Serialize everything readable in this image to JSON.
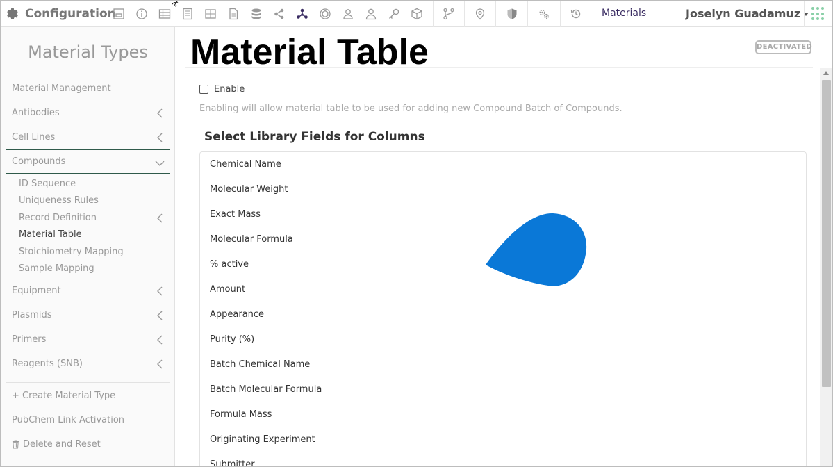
{
  "app": {
    "title": "Configuration"
  },
  "header": {
    "nav_link": "Materials",
    "user_name": "Joselyn Guadamuz",
    "icons": [
      "form-icon",
      "info-icon",
      "table-icon",
      "notebook-icon",
      "grid-icon",
      "document-icon",
      "database-icon",
      "share-icon",
      "molecule-icon",
      "hexagon-icon",
      "user-group-icon",
      "user-icon",
      "key-icon",
      "cube-icon",
      "branch-icon",
      "location-pin-icon",
      "shield-icon",
      "settings-gears-icon",
      "history-icon",
      "apps-grid-icon"
    ]
  },
  "sidebar": {
    "title": "Material Types",
    "items": {
      "material_management": "Material Management",
      "antibodies": "Antibodies",
      "cell_lines": "Cell Lines",
      "compounds": "Compounds",
      "equipment": "Equipment",
      "plasmids": "Plasmids",
      "primers": "Primers",
      "reagents": "Reagents (SNB)",
      "create_type": "+ Create Material Type",
      "pubchem": "PubChem Link Activation",
      "delete_reset": "Delete and Reset"
    },
    "compound_subitems": [
      "ID Sequence",
      "Uniqueness Rules",
      "Record Definition",
      "Material Table",
      "Stoichiometry Mapping",
      "Sample Mapping"
    ],
    "active_subitem": "Material Table"
  },
  "main": {
    "title": "Material Table",
    "status_badge": "DEACTIVATED",
    "enable_label": "Enable",
    "enable_checked": false,
    "help_text": "Enabling will allow material table to be used for adding new Compound Batch of Compounds.",
    "section_title": "Select Library Fields for Columns",
    "fields": [
      "Chemical Name",
      "Molecular Weight",
      "Exact Mass",
      "Molecular Formula",
      "% active",
      "Amount",
      "Appearance",
      "Purity (%)",
      "Batch Chemical Name",
      "Batch Molecular Formula",
      "Formula Mass",
      "Originating Experiment",
      "Submitter"
    ]
  },
  "colors": {
    "accent_dark": "#3b2d63",
    "sidebar_rule": "#2f5a4a",
    "blob": "#0a78d7",
    "apps_dots": "#8ad0a8"
  }
}
